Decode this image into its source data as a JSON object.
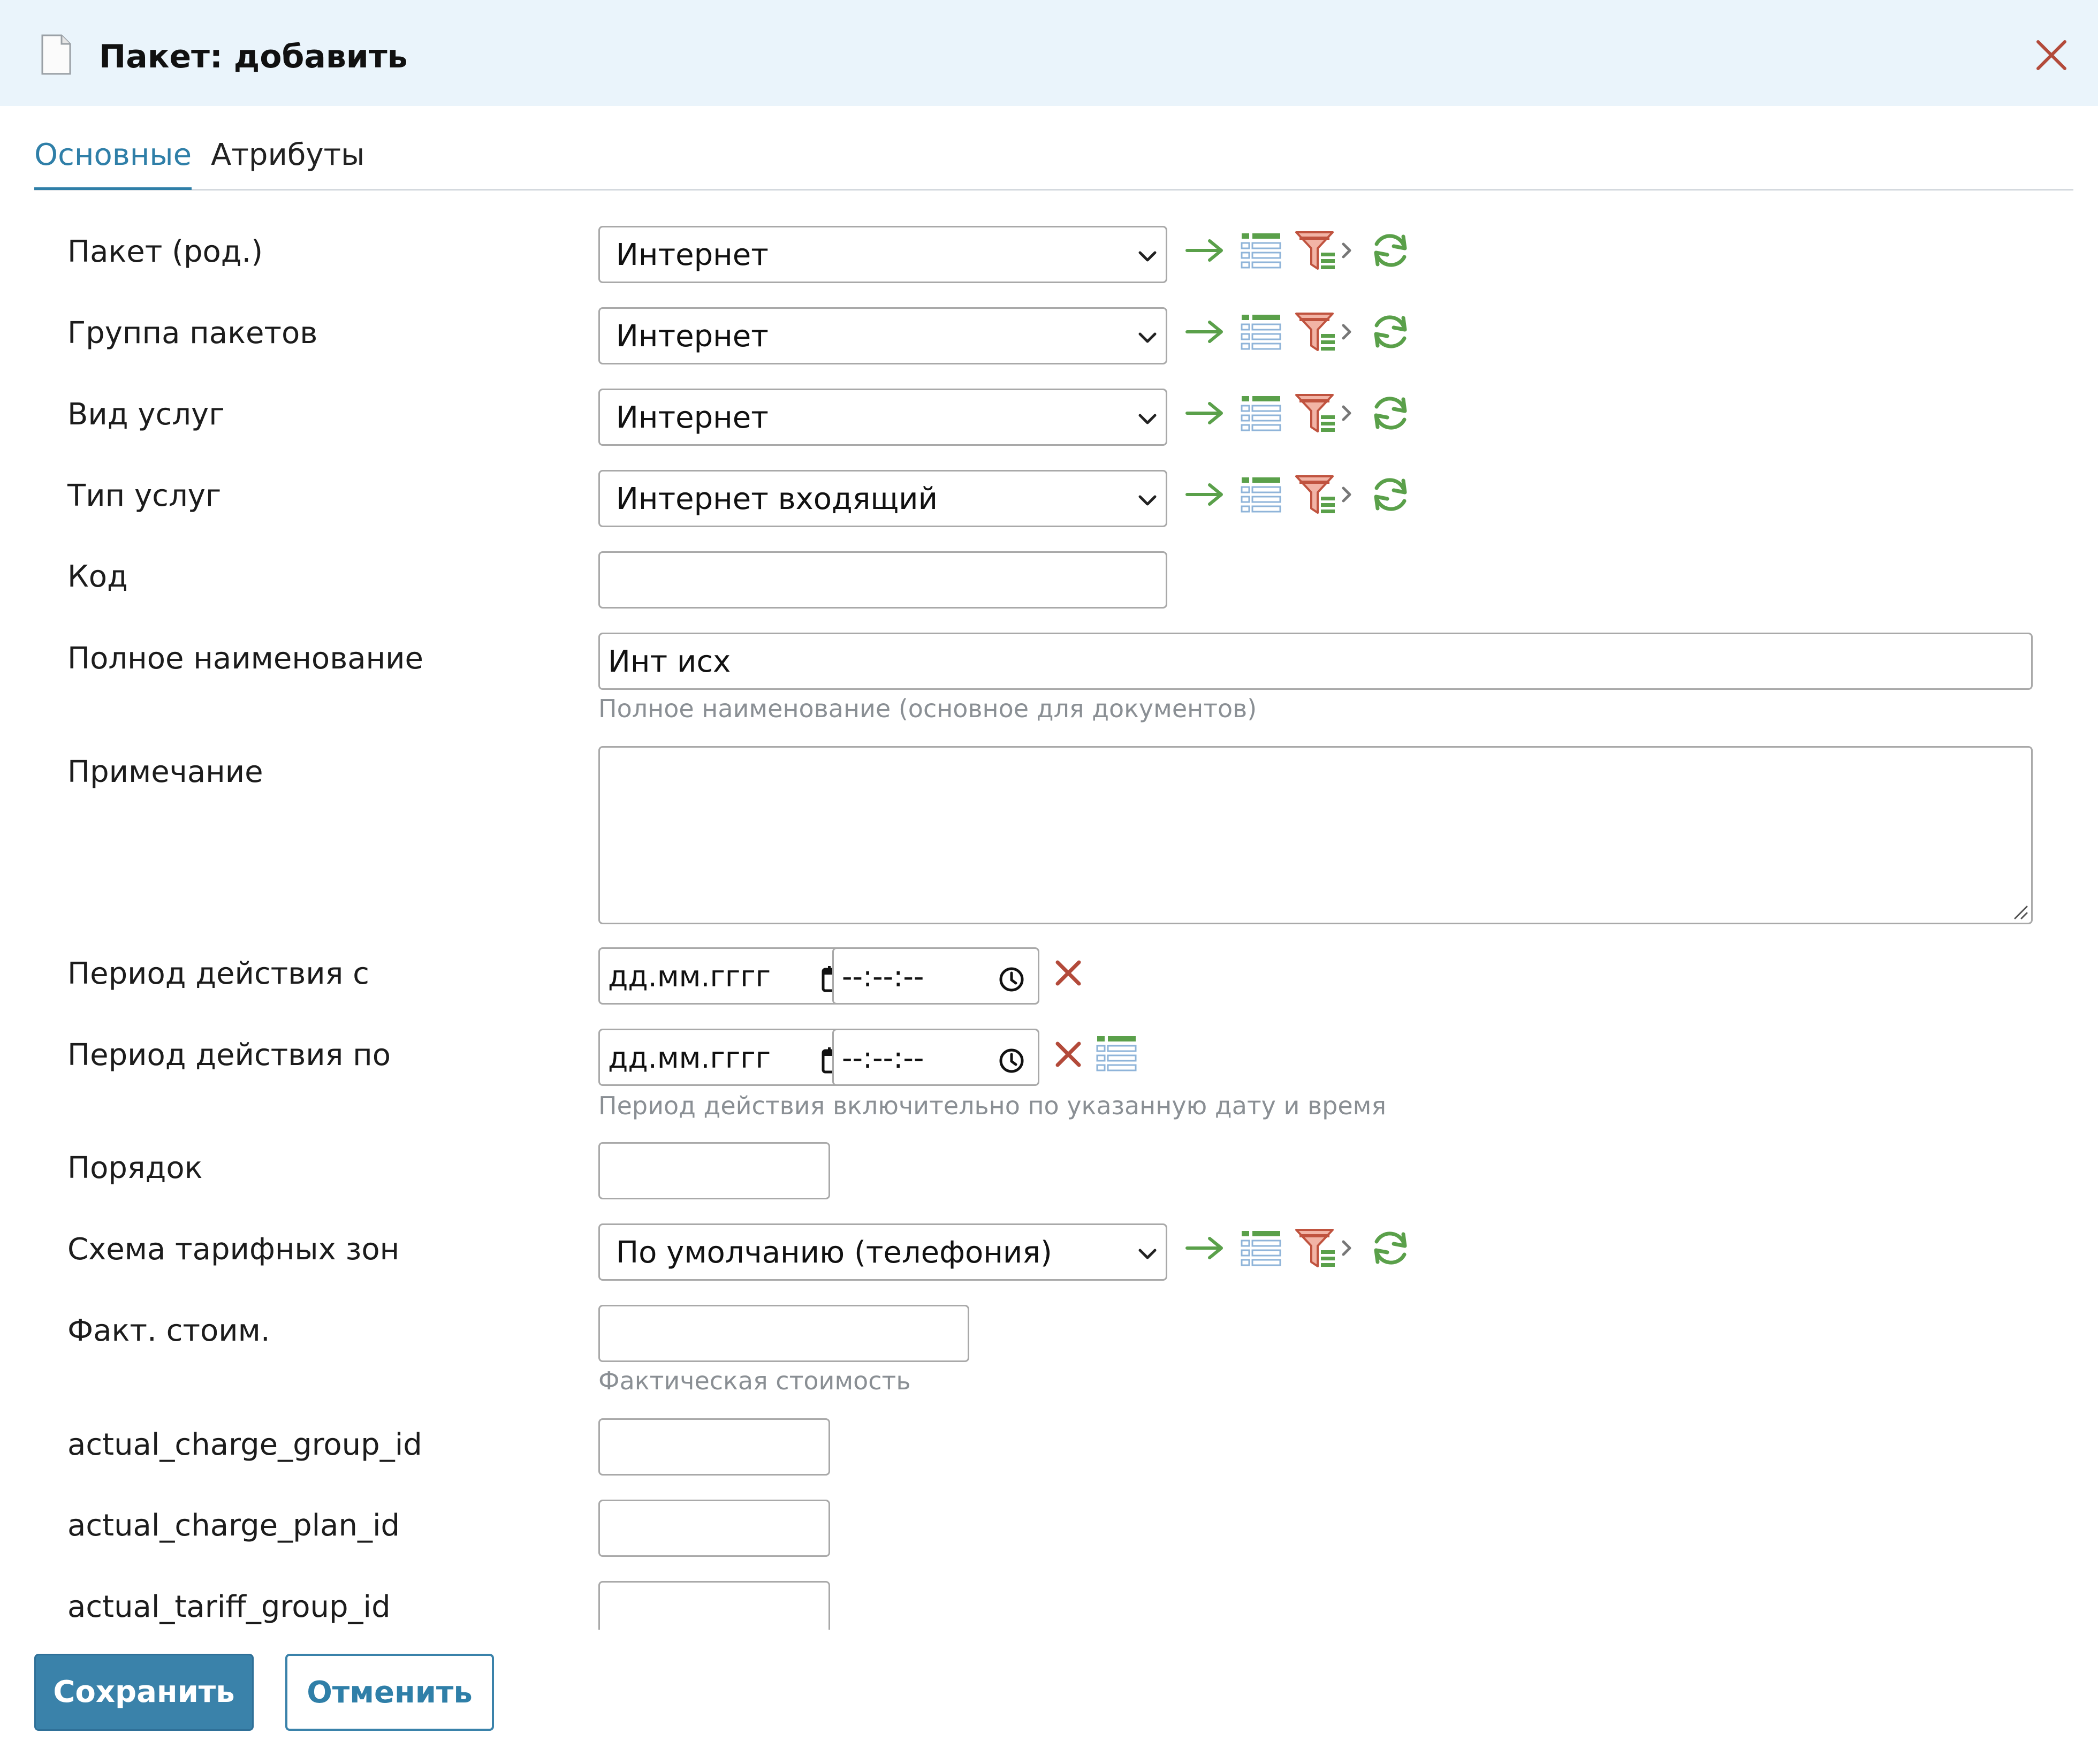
{
  "window": {
    "title": "Пакет: добавить"
  },
  "tabs": [
    {
      "label": "Основные",
      "active": true
    },
    {
      "label": "Атрибуты",
      "active": false
    }
  ],
  "fields": {
    "parent_package": {
      "label": "Пакет (род.)",
      "value": "Интернет"
    },
    "package_group": {
      "label": "Группа пакетов",
      "value": "Интернет"
    },
    "service_kind": {
      "label": "Вид услуг",
      "value": "Интернет"
    },
    "service_type": {
      "label": "Тип услуг",
      "value": "Интернет входящий"
    },
    "code": {
      "label": "Код",
      "value": ""
    },
    "full_name": {
      "label": "Полное наименование",
      "value": "Инт исх",
      "hint": "Полное наименование (основное для документов)"
    },
    "note": {
      "label": "Примечание",
      "value": ""
    },
    "period_from": {
      "label": "Период действия с",
      "date_placeholder": "дд.мм.гггг",
      "time_placeholder": "--:--:--"
    },
    "period_to": {
      "label": "Период действия по",
      "date_placeholder": "дд.мм.гггг",
      "time_placeholder": "--:--:--",
      "hint": "Период действия включительно по указанную дату и время"
    },
    "order": {
      "label": "Порядок",
      "value": ""
    },
    "tariff_zone_scheme": {
      "label": "Схема тарифных зон",
      "value": "По умолчанию (телефония)"
    },
    "actual_cost": {
      "label": "Факт. стоим.",
      "value": "",
      "hint": "Фактическая стоимость"
    },
    "actual_charge_group_id": {
      "label": "actual_charge_group_id",
      "value": ""
    },
    "actual_charge_plan_id": {
      "label": "actual_charge_plan_id",
      "value": ""
    },
    "actual_tariff_group_id": {
      "label": "actual_tariff_group_id",
      "value": ""
    }
  },
  "icons": {
    "header": "document-icon",
    "close": "close-icon",
    "row_actions": [
      "arrow-right-icon",
      "list-icon",
      "filter-list-icon",
      "chevron-right-icon",
      "refresh-icon"
    ],
    "clear": "clear-x-icon",
    "calendar": "calendar-icon",
    "clock": "clock-icon"
  },
  "colors": {
    "header_bg": "#eaf4fb",
    "accent": "#3a82aa",
    "icon_green": "#5aa04a",
    "icon_red": "#b34a3a",
    "hint": "#8a8f94"
  },
  "buttons": {
    "save": "Сохранить",
    "cancel": "Отменить"
  }
}
